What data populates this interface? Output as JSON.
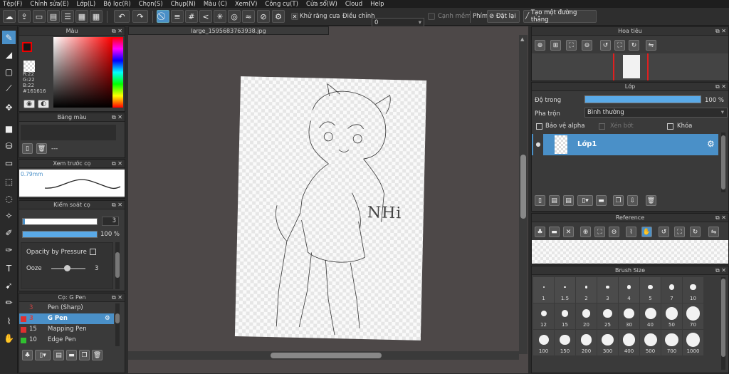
{
  "menu": [
    "Tệp(F)",
    "Chỉnh sửa(E)",
    "Lớp(L)",
    "Bộ lọc(R)",
    "Chọn(S)",
    "Chụp(N)",
    "Màu (C)",
    "Xem(V)",
    "Công cụ(T)",
    "Cửa sổ(W)",
    "Cloud",
    "Help"
  ],
  "toolbar": {
    "antialias": "Khử răng cưa",
    "adjust_label": "Điều chỉnh",
    "adjust_value": "0",
    "smooth_edge": "Cạnh mềm",
    "key_label": "Phím",
    "reset": "Đặt lại",
    "make_line": "Tạo một đường thẳng"
  },
  "color_panel": {
    "title": "Màu",
    "r": "R:22",
    "g": "G:22",
    "b": "B:22",
    "hex": "#161616"
  },
  "palette_panel": {
    "title": "Bảng màu",
    "value": "---"
  },
  "preview_panel": {
    "title": "Xem trước cọ",
    "size": "0.79mm"
  },
  "brush_control": {
    "title": "Kiểm soát cọ",
    "size_value": "3",
    "opacity_pct": "100 %",
    "opacity_pressure": "Opacity by Pressure",
    "ooze_label": "Ooze",
    "ooze_value": "3"
  },
  "brush_list": {
    "title": "Cọ: G Pen",
    "items": [
      {
        "size": "3",
        "name": "Pen (Sharp)",
        "color": "#3a3a3a"
      },
      {
        "size": "3",
        "name": "G Pen",
        "color": "#e03030"
      },
      {
        "size": "15",
        "name": "Mapping Pen",
        "color": "#e03030"
      },
      {
        "size": "10",
        "name": "Edge Pen",
        "color": "#30c030"
      }
    ]
  },
  "canvas": {
    "tab": "large_1595683763938.jpg",
    "sketch_text": "NHi"
  },
  "navigator": {
    "title": "Hoa tiêu"
  },
  "layers": {
    "title": "Lớp",
    "opacity_label": "Độ trong",
    "opacity_value": "100 %",
    "blend_label": "Pha trộn",
    "blend_value": "Bình thường",
    "protect_alpha": "Bảo vệ alpha",
    "clipping": "Xén bớt",
    "lock": "Khóa",
    "layer_name": "Lớp1"
  },
  "reference": {
    "title": "Reference"
  },
  "brush_size": {
    "title": "Brush Size",
    "sizes": [
      "1",
      "1.5",
      "2",
      "3",
      "4",
      "5",
      "7",
      "10",
      "12",
      "15",
      "20",
      "25",
      "30",
      "40",
      "50",
      "70",
      "100",
      "150",
      "200",
      "300",
      "400",
      "500",
      "700",
      "1000"
    ]
  },
  "colors": {
    "accent": "#4a90c8",
    "fg": "#161616"
  }
}
